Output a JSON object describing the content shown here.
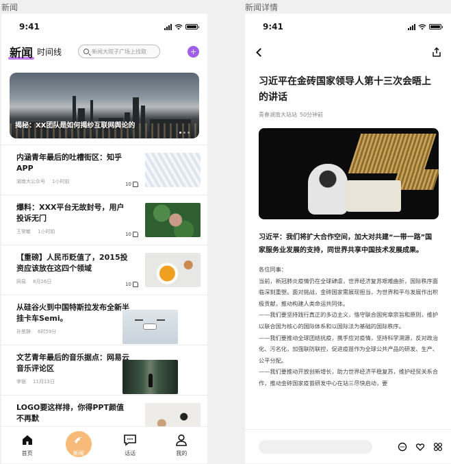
{
  "labels": {
    "left": "新闻",
    "right": "新闻详情"
  },
  "status": {
    "time": "9:41"
  },
  "news": {
    "brand": "新闻",
    "timeline": "时间线",
    "search_placeholder": "新闻大院子广场上找取",
    "plus_icon": "plus-icon",
    "hero_caption": "揭秘：XX团队是如何揭纱互联网舆论的",
    "items": [
      {
        "title": "内涵青年最后的吐槽街区：知乎APP",
        "source": "湖南大公众号",
        "time": "1小时前",
        "likes": "10",
        "image": "glass-building"
      },
      {
        "title": "爆料：XXX平台无故封号，用户投诉无门",
        "source": "王常敏",
        "time": "1小时前",
        "likes": "10",
        "image": "plant-portrait"
      },
      {
        "title": "【重磅】人民币贬值了，2015投资应该放在这四个领域",
        "source": "网易",
        "time": "8月26日",
        "likes": "10",
        "image": "food-bowl"
      },
      {
        "title": "从硅谷火到中国特斯拉发布全新半挂卡车Semi。",
        "source": "孙思静",
        "time": "6时59分",
        "likes": "10",
        "image": "drone"
      },
      {
        "title": "文艺青年最后的音乐据点：网易云音乐评论区",
        "source": "李银",
        "time": "11月13日",
        "likes": "10",
        "image": "forest-person"
      },
      {
        "title": "LOGO要这样排，你得PPT颜值不再默",
        "source": "",
        "time": "",
        "likes": "",
        "image": "desk"
      }
    ],
    "tabs": [
      {
        "label": "首页",
        "icon": "home-icon"
      },
      {
        "label": "新闻",
        "icon": "news-icon"
      },
      {
        "label": "话话",
        "icon": "chat-icon"
      },
      {
        "label": "我的",
        "icon": "profile-icon"
      }
    ]
  },
  "detail": {
    "title": "习近平在金砖国家领导人第十三次会晤上的讲话",
    "source": "青春湖南大站站",
    "time": "50分钟前",
    "lead": "习近平：我们将扩大合作空间，加大对共建“一带一路”国家服务业发展的支持，同世界共享中国技术发展成果。",
    "body": [
      "各位同事：",
      "当前，新冠肺炎疫情仍在全球肆虐，世界经济复苏艰难曲折，国际秩序面临深刻重塑。面对挑战，金砖国家需展现担当，为世界和平与发展作出积极贡献，推动构建人类命运共同体。",
      "——我们要坚持践行真正的多边主义，恪守联合国宪章宗旨和原则，维护以联合国为核心的国际体系和以国际法为基础的国际秩序。",
      "——我们要推动全球团结抗疫，携手应对疫情，坚持科学溯源，反对政治化、污名化，加强联防联控，促进疫苗作为全球公共产品的研发、生产、公平分配。",
      "——我们要推动开放创新增长，助力世界经济平稳复苏，维护经贸关系合作，推动金砖国家疫苗研发中心在站三尽快启动，要"
    ]
  }
}
